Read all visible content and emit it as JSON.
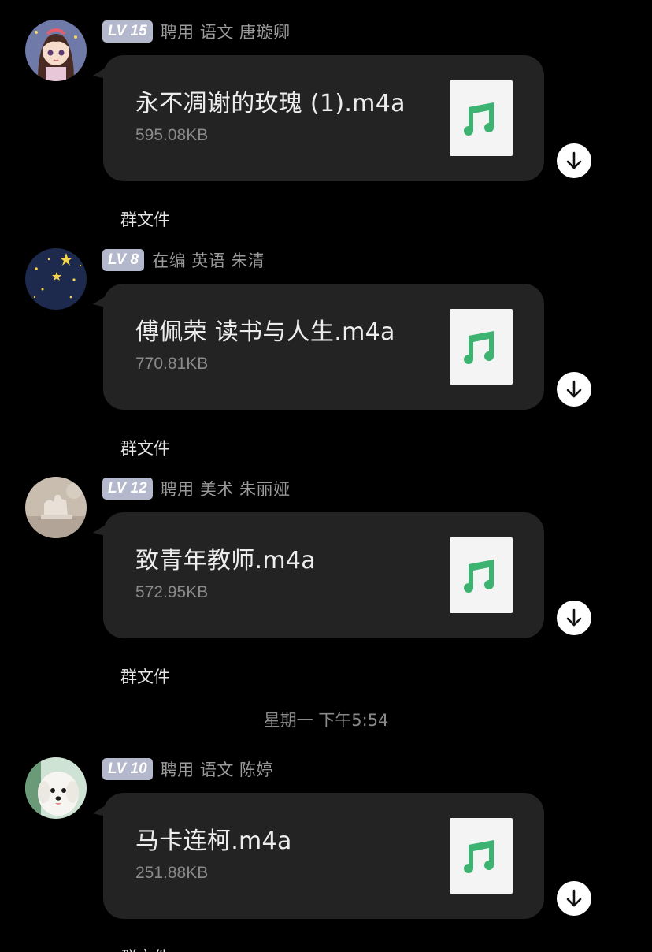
{
  "messages": [
    {
      "level": "LV 15",
      "sender": "聘用 语文 唐璇卿",
      "file": {
        "name": "永不凋谢的玫瑰 (1).m4a",
        "size": "595.08KB",
        "icon": "music-note-icon"
      },
      "source": "群文件"
    },
    {
      "level": "LV 8",
      "sender": "在编 英语 朱清",
      "file": {
        "name": "傅佩荣  读书与人生.m4a",
        "size": "770.81KB",
        "icon": "music-note-icon"
      },
      "source": "群文件"
    },
    {
      "level": "LV 12",
      "sender": "聘用 美术 朱丽娅",
      "file": {
        "name": "致青年教师.m4a",
        "size": "572.95KB",
        "icon": "music-note-icon"
      },
      "source": "群文件"
    },
    {
      "level": "LV 10",
      "sender": "聘用 语文 陈婷",
      "file": {
        "name": "马卡连柯.m4a",
        "size": "251.88KB",
        "icon": "music-note-icon"
      },
      "source": "群文件"
    }
  ],
  "timestamp": "星期一 下午5:54",
  "colors": {
    "background": "#000000",
    "bubble": "#232323",
    "level_badge": "#b4b8cc",
    "music_icon": "#3cb371"
  }
}
